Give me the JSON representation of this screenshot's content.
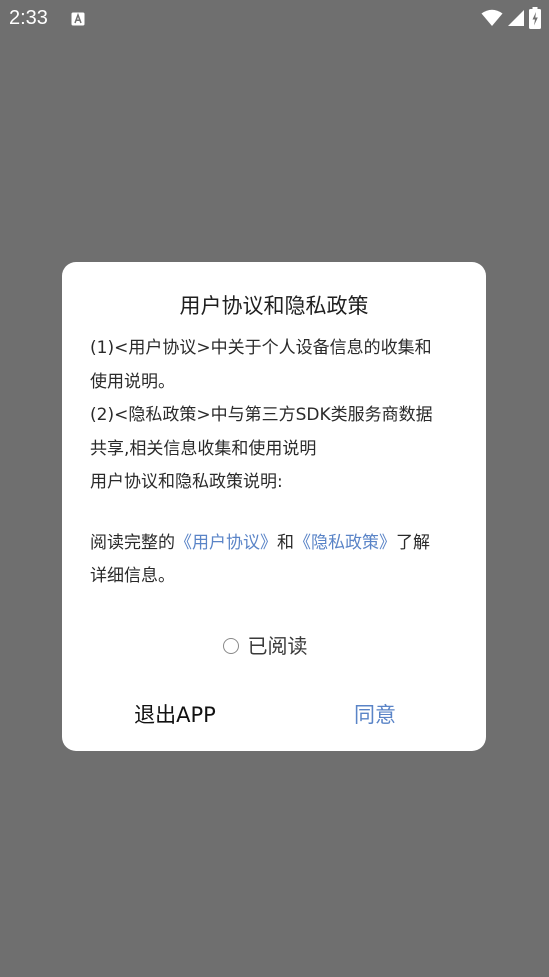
{
  "status_bar": {
    "time": "2:33",
    "notification_icon": "a-box-icon",
    "wifi_icon": "wifi-icon",
    "signal_icon": "cell-signal-icon",
    "battery_icon": "battery-charging-icon"
  },
  "dialog": {
    "title": "用户协议和隐私政策",
    "body_lines": [
      "(1)<用户协议>中关于个人设备信息的收集和",
      "使用说明。",
      "(2)<隐私政策>中与第三方SDK类服务商数据",
      "共享,相关信息收集和使用说明",
      "用户协议和隐私政策说明:"
    ],
    "read_prompt": {
      "prefix": "阅读完整的",
      "user_agreement_link": "《用户协议》",
      "and": "和",
      "privacy_policy_link": "《隐私政策》",
      "suffix_line1": "了解",
      "suffix_line2": "详细信息。"
    },
    "read_checkbox_label": "已阅读",
    "exit_button": "退出APP",
    "agree_button": "同意"
  },
  "colors": {
    "overlay": "#6f6f6f",
    "dialog_bg": "#ffffff",
    "link": "#5a84c7",
    "text": "#2a2a2a"
  }
}
